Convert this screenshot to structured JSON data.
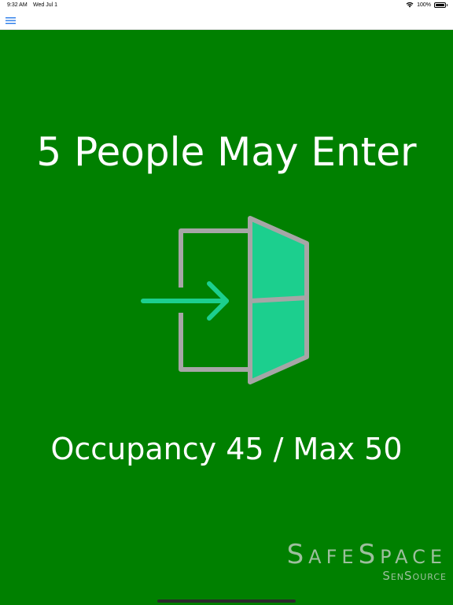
{
  "status_bar": {
    "time": "9:32 AM",
    "date": "Wed Jul 1",
    "battery_text": "100%",
    "battery_level": 1.0,
    "wifi_icon": "wifi-icon",
    "battery_icon": "battery-icon"
  },
  "nav": {
    "menu_icon": "hamburger-menu-icon",
    "accent_color": "#1a73e8"
  },
  "main": {
    "background_color": "#008000",
    "headline": "5 People May Enter",
    "entry_icon": "enter-door-icon",
    "occupancy_text": "Occupancy 45 / Max 50"
  },
  "logo": {
    "brand": "SafeSpace",
    "company": "SenSource"
  }
}
